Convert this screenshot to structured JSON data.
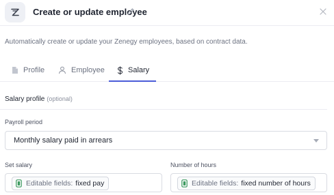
{
  "header": {
    "title": "Create or update employee",
    "logo_icon": "zenegy-logo-icon",
    "edit_icon": "pencil-icon",
    "close_icon": "close-icon"
  },
  "description": "Automatically create or update your Zenegy employees, based on contract data.",
  "tabs": [
    {
      "label": "Profile",
      "icon": "document-icon",
      "active": false
    },
    {
      "label": "Employee",
      "icon": "person-icon",
      "active": false
    },
    {
      "label": "Salary",
      "icon": "dollar-icon",
      "active": true
    }
  ],
  "section": {
    "title": "Salary profile",
    "optional": "(optional)"
  },
  "payroll_period": {
    "label": "Payroll period",
    "value": "Monthly salary paid in arrears"
  },
  "set_salary": {
    "label": "Set salary",
    "chip_prefix": "Editable fields:",
    "chip_value": "fixed pay",
    "chip_icon": "editable-field-icon"
  },
  "number_of_hours": {
    "label": "Number of hours",
    "chip_prefix": "Editable fields:",
    "chip_value": "fixed number of hours",
    "chip_icon": "editable-field-icon"
  },
  "colors": {
    "accent": "#4a5bd8",
    "chip_icon_green": "#3c9a5f"
  }
}
